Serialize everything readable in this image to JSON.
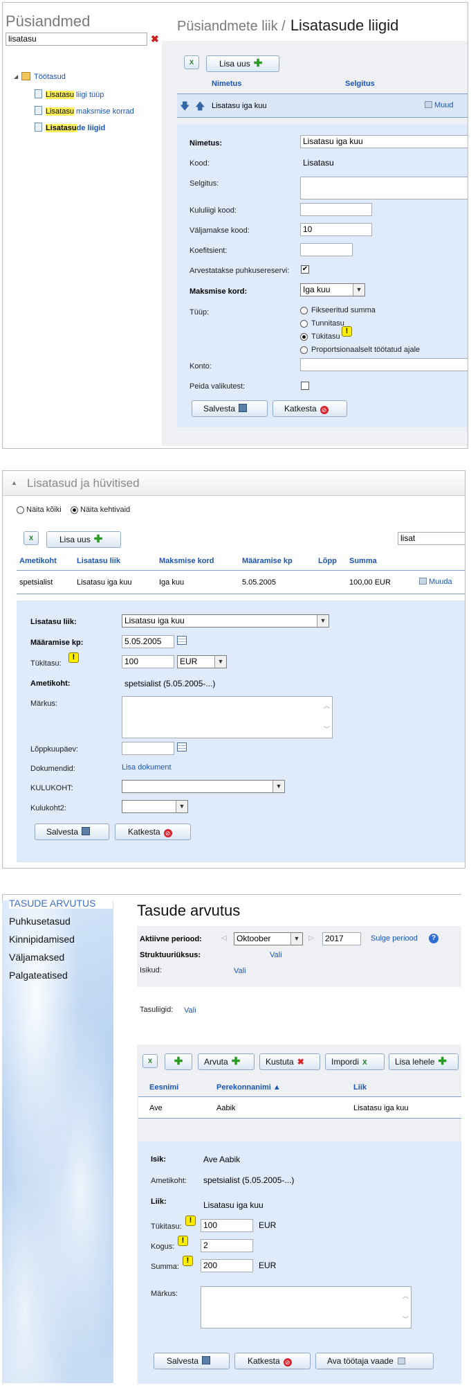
{
  "panel1": {
    "title": "Püsiandmed",
    "search_value": "lisatasu",
    "tree": {
      "root": "Töötasud",
      "items": [
        {
          "hl": "Lisatasu",
          "rest": " liigi tüüp"
        },
        {
          "hl": "Lisatasu",
          "rest": " maksmise korrad"
        },
        {
          "hl": "Lisatasu",
          "rest": "de liigid"
        }
      ]
    },
    "breadcrumb": "Püsiandmete liik /",
    "heading": "Lisatasude liigid",
    "add_button": "Lisa uus",
    "columns": [
      "Nimetus",
      "Selgitus"
    ],
    "row": {
      "name": "Lisatasu iga kuu",
      "edit": "Muud"
    },
    "form": {
      "nimetus_label": "Nimetus:",
      "nimetus_value": "Lisatasu iga kuu",
      "kood_label": "Kood:",
      "kood_value": "Lisatasu",
      "selgitus_label": "Selgitus:",
      "kululiigi_label": "Kululiigi kood:",
      "valjamakse_label": "Väljamakse kood:",
      "valjamakse_value": "10",
      "koefitsient_label": "Koefitsient:",
      "puhkusereserv_label": "Arvestatakse puhkusereservi:",
      "maksmise_label": "Maksmise kord:",
      "maksmise_value": "Iga kuu",
      "tyyp_label": "Tüüp:",
      "tyyp_options": [
        "Fikseeritud summa",
        "Tunnitasu",
        "Tükitasu",
        "Proportsionaalselt töötatud ajale"
      ],
      "konto_label": "Konto:",
      "peida_label": "Peida valikutest:",
      "save": "Salvesta",
      "cancel": "Katkesta"
    }
  },
  "panel2": {
    "title": "Lisatasud ja hüvitised",
    "filter_all": "Näita kõiki",
    "filter_active": "Näita kehtivaid",
    "add_button": "Lisa uus",
    "search_value": "lisat",
    "columns": [
      "Ametikoht",
      "Lisatasu liik",
      "Maksmise kord",
      "Määramise kp",
      "Lõpp",
      "Summa"
    ],
    "row": [
      "spetsialist",
      "Lisatasu iga kuu",
      "Iga kuu",
      "5.05.2005",
      "",
      "100,00 EUR"
    ],
    "row_edit": "Muuda",
    "form": {
      "liik_label": "Lisatasu liik:",
      "liik_value": "Lisatasu iga kuu",
      "kp_label": "Määramise kp:",
      "kp_value": "5.05.2005",
      "tykitasu_label": "Tükitasu:",
      "tykitasu_value": "100",
      "currency": "EUR",
      "ametikoht_label": "Ametikoht:",
      "ametikoht_value": "spetsialist (5.05.2005-...)",
      "markus_label": "Märkus:",
      "lopp_label": "Lõppkuupäev:",
      "dok_label": "Dokumendid:",
      "dok_link": "Lisa dokument",
      "kulukoht_label": "KULUKOHT:",
      "kulukoht2_label": "Kulukoht2:",
      "save": "Salvesta",
      "cancel": "Katkesta"
    }
  },
  "panel3": {
    "menu": [
      "TASUDE ARVUTUS",
      "Puhkusetasud",
      "Kinnipidamised",
      "Väljamaksed",
      "Palgateatised"
    ],
    "title": "Tasude arvutus",
    "period_label": "Aktiivne periood:",
    "month": "Oktoober",
    "year": "2017",
    "close_period": "Sulge periood",
    "struct_label": "Struktuuriüksus:",
    "struct_link": "Vali",
    "persons_label": "Isikud:",
    "persons_link": "Vali",
    "pay_type_label": "Tasuliigid:",
    "pay_type_link": "Vali",
    "toolbar": {
      "calc": "Arvuta",
      "delete": "Kustuta",
      "import": "Impordi",
      "add_page": "Lisa lehele"
    },
    "columns": [
      "Eesnimi",
      "Perekonnanimi ▲",
      "Liik"
    ],
    "row": [
      "Ave",
      "Aabik",
      "Lisatasu iga kuu"
    ],
    "form": {
      "isik_label": "Isik:",
      "isik_value": "Ave Aabik",
      "ametikoht_label": "Ametikoht:",
      "ametikoht_value": "spetsialist (5.05.2005-...)",
      "liik_label": "Liik:",
      "liik_value": "Lisatasu iga kuu",
      "tykitasu_label": "Tükitasu:",
      "tykitasu_value": "100",
      "tykitasu_unit": "EUR",
      "kogus_label": "Kogus:",
      "kogus_value": "2",
      "summa_label": "Summa:",
      "summa_value": "200",
      "summa_unit": "EUR",
      "markus_label": "Märkus:",
      "save": "Salvesta",
      "cancel": "Katkesta",
      "open_view": "Ava töötaja vaade"
    }
  }
}
